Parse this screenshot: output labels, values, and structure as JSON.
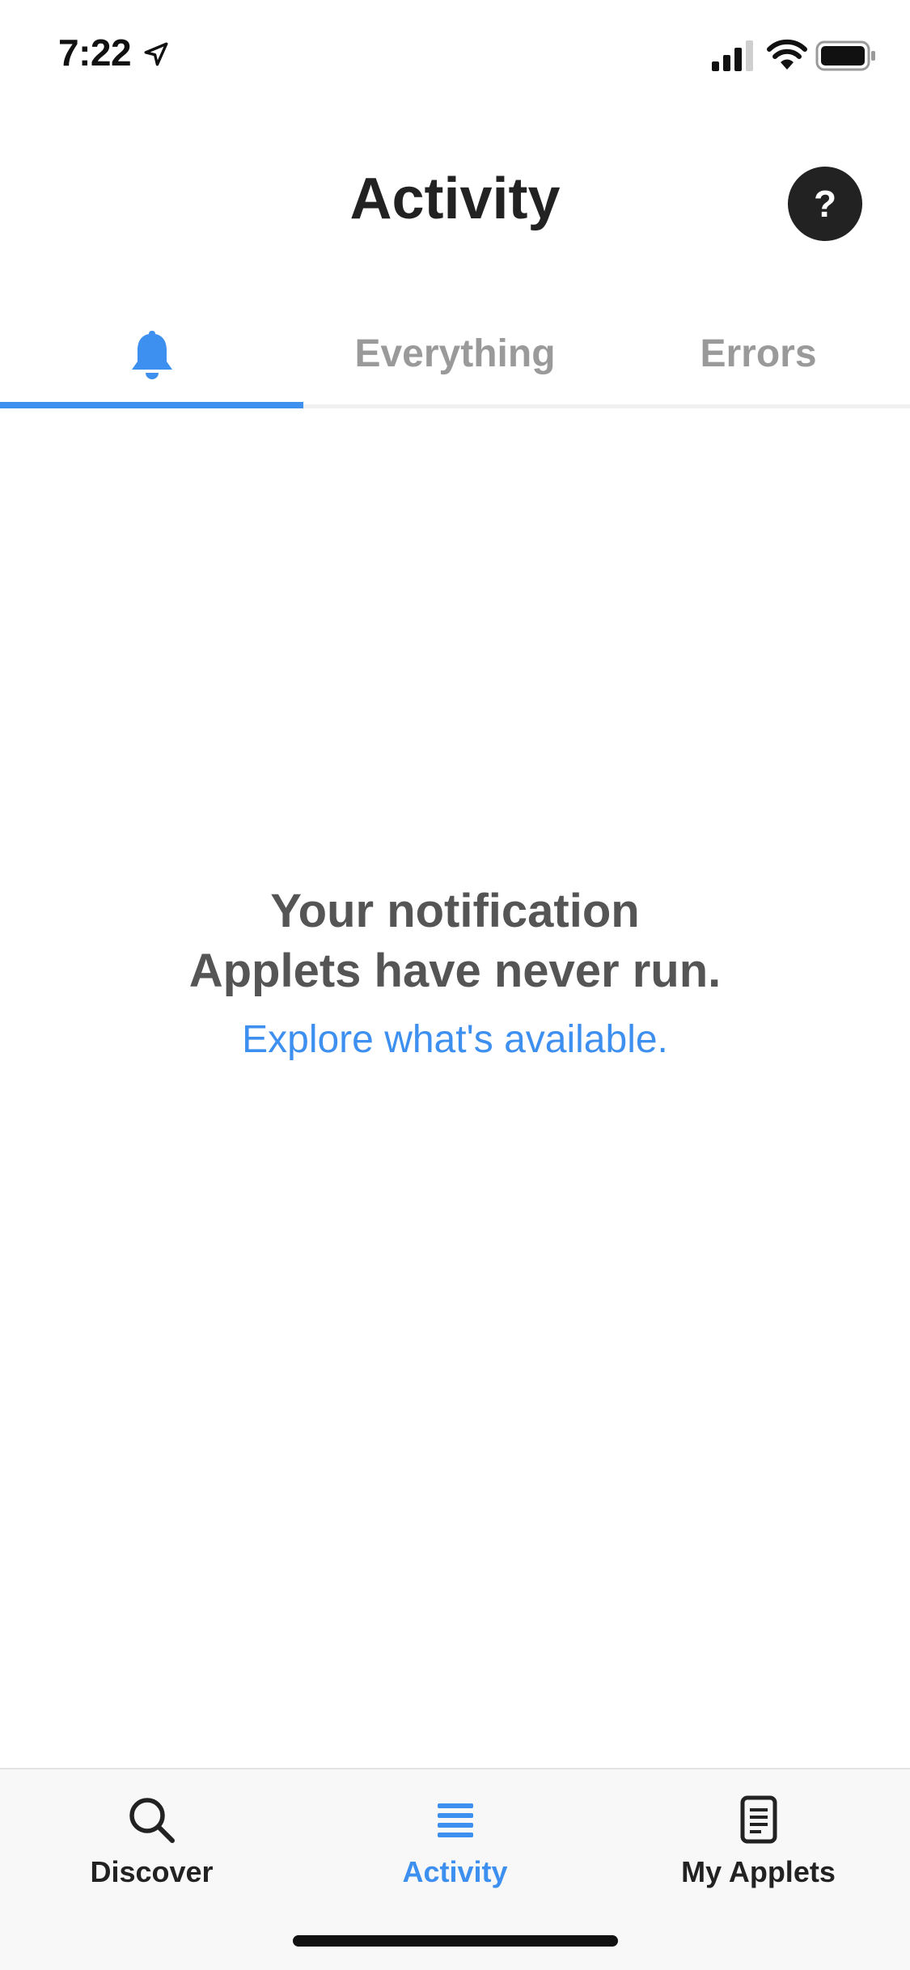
{
  "status_bar": {
    "time": "7:22",
    "icons": [
      "location-arrow-icon",
      "cellular-signal-icon",
      "wifi-icon",
      "battery-icon"
    ]
  },
  "header": {
    "title": "Activity",
    "help_label": "?"
  },
  "tabs": [
    {
      "label": "",
      "icon": "bell-icon",
      "active": true
    },
    {
      "label": "Everything",
      "active": false
    },
    {
      "label": "Errors",
      "active": false
    }
  ],
  "empty_state": {
    "line1": "Your notification",
    "line2": "Applets have never run.",
    "link": "Explore what's available."
  },
  "bottom_nav": {
    "items": [
      {
        "label": "Discover",
        "icon": "search-icon",
        "active": false
      },
      {
        "label": "Activity",
        "icon": "list-icon",
        "active": true
      },
      {
        "label": "My Applets",
        "icon": "document-icon",
        "active": false
      }
    ]
  },
  "colors": {
    "accent": "#3d8ff0",
    "title": "#222222",
    "muted_tab": "#9a9a9a",
    "empty_text": "#555555",
    "nav_background": "#f8f8f8"
  }
}
